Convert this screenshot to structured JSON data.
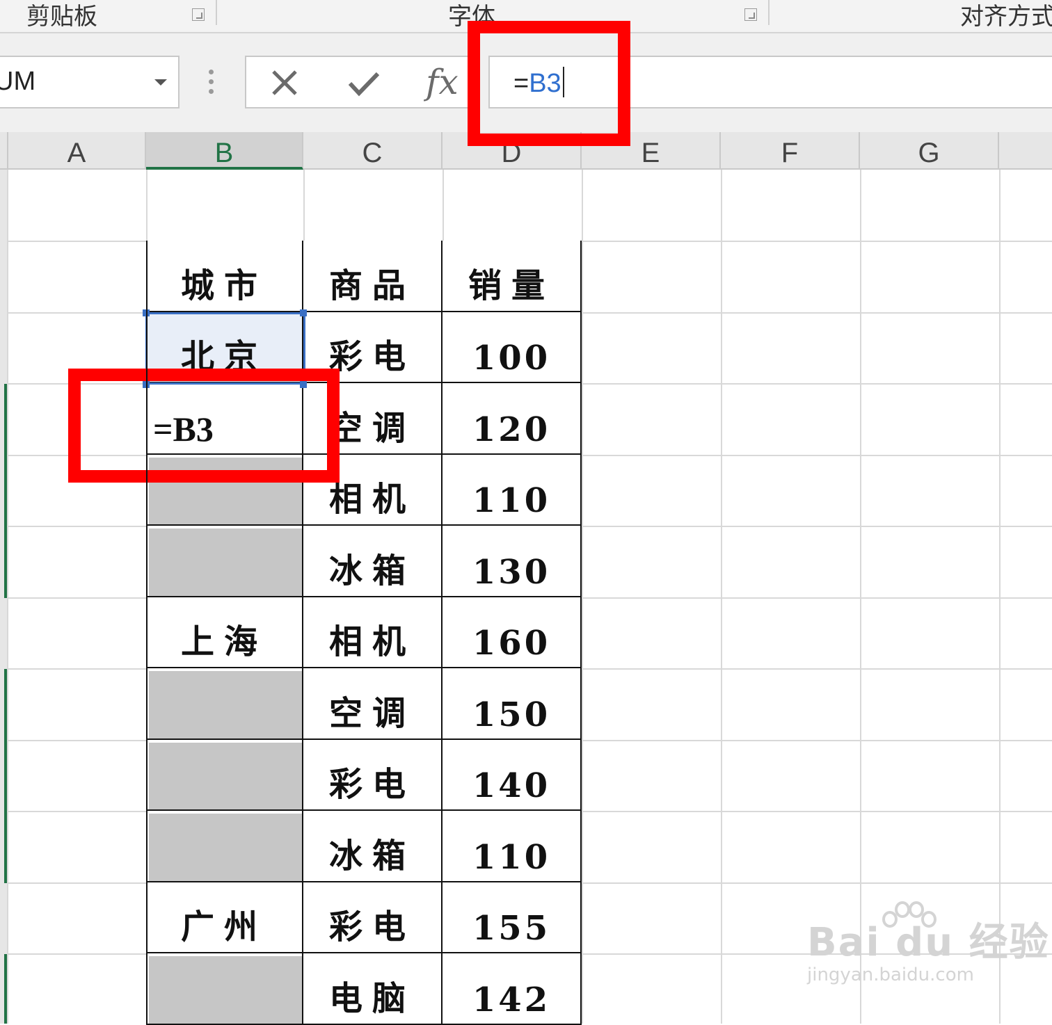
{
  "ribbon": {
    "groups": [
      {
        "label": "剪贴板"
      },
      {
        "label": "字体"
      },
      {
        "label": "对齐方式"
      }
    ]
  },
  "formula_bar": {
    "name_box_value": "UM",
    "cancel_icon": "close-icon",
    "enter_icon": "check-icon",
    "insert_function_label": "fx",
    "formula_prefix": "=",
    "formula_ref": "B3"
  },
  "columns": [
    "A",
    "B",
    "C",
    "D",
    "E",
    "F",
    "G"
  ],
  "selected_column": "B",
  "table": {
    "headers": [
      "城市",
      "商品",
      "销量"
    ],
    "rows": [
      {
        "city": "北京",
        "product": "彩电",
        "sales": "100",
        "city_state": "active"
      },
      {
        "city": "=B3",
        "product": "空调",
        "sales": "120",
        "city_state": "editing"
      },
      {
        "city": "",
        "product": "相机",
        "sales": "110",
        "city_state": "gray"
      },
      {
        "city": "",
        "product": "冰箱",
        "sales": "130",
        "city_state": "gray"
      },
      {
        "city": "上海",
        "product": "相机",
        "sales": "160",
        "city_state": "normal"
      },
      {
        "city": "",
        "product": "空调",
        "sales": "150",
        "city_state": "gray"
      },
      {
        "city": "",
        "product": "彩电",
        "sales": "140",
        "city_state": "gray"
      },
      {
        "city": "",
        "product": "冰箱",
        "sales": "110",
        "city_state": "gray"
      },
      {
        "city": "广州",
        "product": "彩电",
        "sales": "155",
        "city_state": "normal"
      },
      {
        "city": "",
        "product": "电脑",
        "sales": "142",
        "city_state": "gray"
      }
    ]
  },
  "annotation_color": "#ff0000",
  "accent_color": "#217346",
  "watermark": {
    "main": "Bai du 经验",
    "sub": "jingyan.baidu.com"
  }
}
